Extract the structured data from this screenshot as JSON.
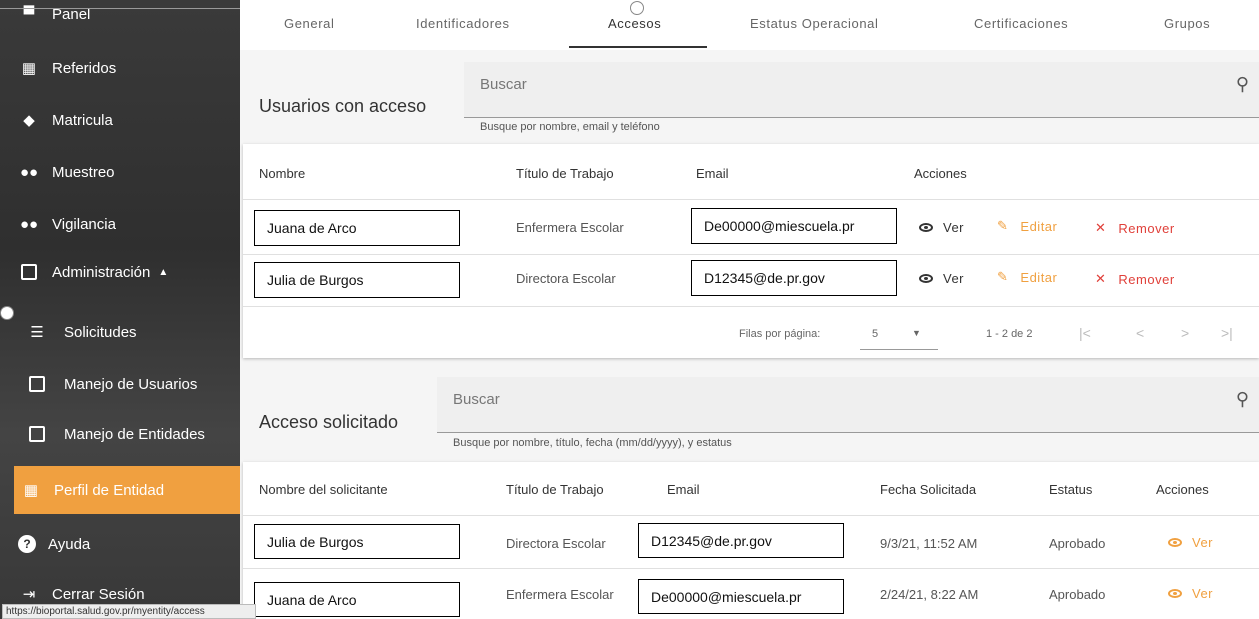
{
  "sidebar": {
    "items": [
      {
        "label": "Panel",
        "icon": "dashboard-icon",
        "glyph": "▀▀"
      },
      {
        "label": "Referidos",
        "icon": "building-icon",
        "glyph": "▦"
      },
      {
        "label": "Matricula",
        "icon": "graduation-cap-icon",
        "glyph": "◆"
      },
      {
        "label": "Muestreo",
        "icon": "people-icon",
        "glyph": "👥"
      },
      {
        "label": "Vigilancia",
        "icon": "people-icon",
        "glyph": "👥"
      },
      {
        "label": "Administración",
        "icon": "settings-box-icon",
        "glyph": "⚙",
        "suffix": "▲"
      },
      {
        "label": "Solicitudes",
        "icon": "document-list-icon",
        "glyph": "☰"
      },
      {
        "label": "Manejo de Usuarios",
        "icon": "account-box-icon",
        "glyph": "▣"
      },
      {
        "label": "Manejo de Entidades",
        "icon": "account-box-icon",
        "glyph": "▣"
      },
      {
        "label": "Perfil de Entidad",
        "icon": "building-icon",
        "glyph": "▦"
      },
      {
        "label": "Ayuda",
        "icon": "help-icon",
        "glyph": "?"
      },
      {
        "label": "Cerrar Sesión",
        "icon": "logout-icon",
        "glyph": "⇥"
      }
    ],
    "status_url": "https://bioportal.salud.gov.pr/myentity/access"
  },
  "tabs": [
    "General",
    "Identificadores",
    "Accesos",
    "Estatus Operacional",
    "Certificaciones",
    "Grupos"
  ],
  "users_section": {
    "title": "Usuarios con acceso",
    "search_placeholder": "Buscar",
    "search_hint": "Busque por nombre, email y teléfono",
    "headers": {
      "name": "Nombre",
      "job": "Título de Trabajo",
      "email": "Email",
      "actions": "Acciones"
    },
    "rows": [
      {
        "name": "Juana de Arco",
        "job": "Enfermera Escolar",
        "email": "De00000@miescuela.pr"
      },
      {
        "name": "Julia de Burgos",
        "job": "Directora Escolar",
        "email": "D12345@de.pr.gov"
      }
    ],
    "actions": {
      "view": "Ver",
      "edit": "Editar",
      "remove": "Remover"
    },
    "pagination": {
      "rows_label": "Filas por página:",
      "rows_value": "5",
      "range": "1 - 2 de 2"
    }
  },
  "requests_section": {
    "title": "Acceso solicitado",
    "search_placeholder": "Buscar",
    "search_hint": "Busque por nombre, título, fecha (mm/dd/yyyy), y estatus",
    "headers": {
      "name": "Nombre del solicitante",
      "job": "Título de Trabajo",
      "email": "Email",
      "date": "Fecha Solicitada",
      "status": "Estatus",
      "actions": "Acciones"
    },
    "rows": [
      {
        "name": "Julia de Burgos",
        "job": "Directora Escolar",
        "email": "D12345@de.pr.gov",
        "date": "9/3/21, 11:52 AM",
        "status": "Aprobado"
      },
      {
        "name": "Juana de Arco",
        "job": "Enfermera Escolar",
        "email": "De00000@miescuela.pr",
        "date": "2/24/21, 8:22 AM",
        "status": "Aprobado"
      }
    ],
    "view": "Ver"
  },
  "colors": {
    "accent": "#f0a040",
    "danger": "#e0403a",
    "sidebar_bg": "#333333"
  }
}
